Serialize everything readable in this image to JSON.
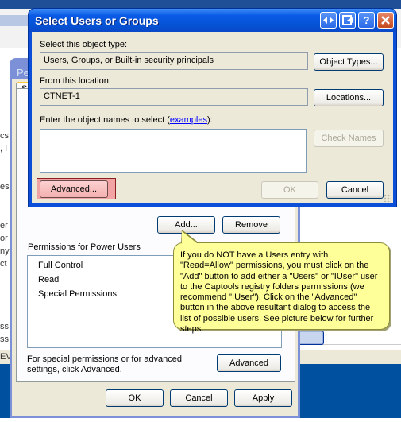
{
  "background_fragments": {
    "perm_title_partial": "Per",
    "tab_partial": "S",
    "left_text": [
      "cs",
      ", I",
      "es",
      "er",
      "or",
      "ny",
      "ct",
      "ss",
      "ss",
      "EV"
    ]
  },
  "permissions_dialog": {
    "add_button": "Add...",
    "remove_button": "Remove",
    "permissions_for_label": "Permissions for Power Users",
    "permissions": [
      "Full Control",
      "Read",
      "Special Permissions"
    ],
    "advanced_hint": "For special permissions or for advanced settings, click Advanced.",
    "advanced_button": "Advanced",
    "ok_button": "OK",
    "cancel_button": "Cancel",
    "apply_button": "Apply"
  },
  "select_dialog": {
    "title": "Select Users or Groups",
    "title_buttons": [
      "arrows-icon",
      "exit-icon",
      "help-icon",
      "close-icon"
    ],
    "help_glyph": "?",
    "object_type_label": "Select this object type:",
    "object_type_value": "Users, Groups, or Built-in security principals",
    "object_types_button": "Object Types...",
    "location_label": "From this location:",
    "location_value": "CTNET-1",
    "locations_button": "Locations...",
    "names_label_prefix": "Enter the object names to select (",
    "names_label_link": "examples",
    "names_label_suffix": "):",
    "names_value": "",
    "check_names_button": "Check Names",
    "advanced_button": "Advanced...",
    "ok_button": "OK",
    "cancel_button": "Cancel"
  },
  "callout": {
    "text": "If you do NOT have a Users entry with \"Read=Allow\" permissions, you must click on the \"Add\" button to add either a \"Users\" or \"IUser\" user to the Captools registry folders permissions (we recommend \"IUser\").  Click on the \"Advanced\" button in the above resultant dialog to access the list of possible users.  See picture below for further steps.",
    "background_color": "#ffff99"
  },
  "colors": {
    "xp_titlebar": "#0453d6",
    "highlight": "#f2a3a3",
    "dialog_face": "#ece9d8"
  }
}
